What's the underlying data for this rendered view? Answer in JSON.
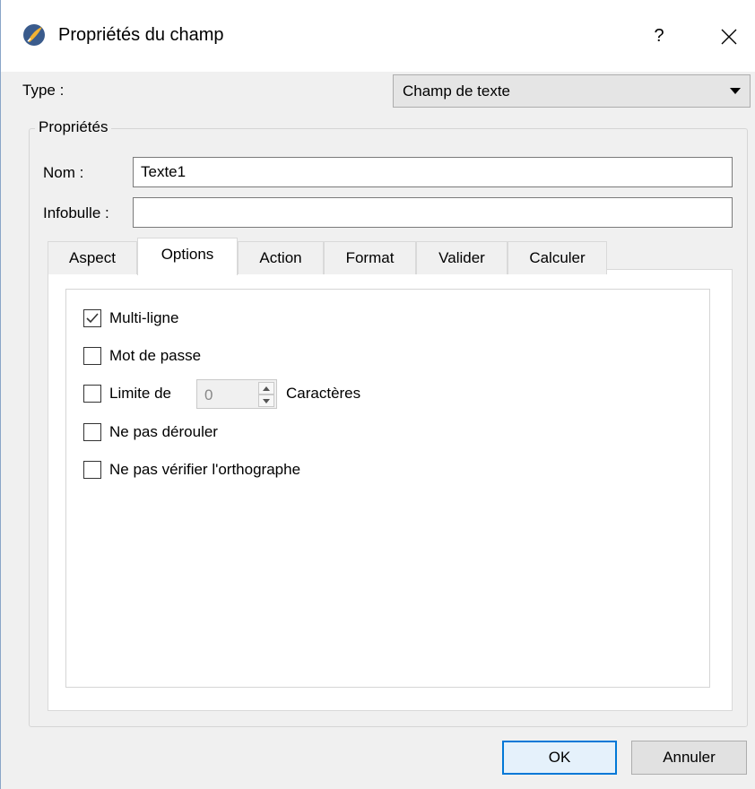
{
  "window": {
    "title": "Propriétés du champ",
    "help_label": "?",
    "close_label": "✕"
  },
  "type_row": {
    "label": "Type :",
    "selected": "Champ de texte"
  },
  "properties_group": {
    "legend": "Propriétés",
    "name_label": "Nom :",
    "name_value": "Texte1",
    "tooltip_label": "Infobulle :",
    "tooltip_value": ""
  },
  "tabs": [
    {
      "label": "Aspect",
      "active": false
    },
    {
      "label": "Options",
      "active": true
    },
    {
      "label": "Action",
      "active": false
    },
    {
      "label": "Format",
      "active": false
    },
    {
      "label": "Valider",
      "active": false
    },
    {
      "label": "Calculer",
      "active": false
    }
  ],
  "options": {
    "multiline": {
      "label": "Multi-ligne",
      "checked": true
    },
    "password": {
      "label": "Mot de passe",
      "checked": false
    },
    "limit": {
      "label": "Limite de",
      "checked": false,
      "value": "0",
      "suffix": "Caractères"
    },
    "no_scroll": {
      "label": "Ne pas dérouler",
      "checked": false
    },
    "no_spellcheck": {
      "label": "Ne pas vérifier l'orthographe",
      "checked": false
    }
  },
  "buttons": {
    "ok": "OK",
    "cancel": "Annuler"
  },
  "colors": {
    "accent": "#0078d7",
    "dialog_bg": "#f0f0f0"
  }
}
